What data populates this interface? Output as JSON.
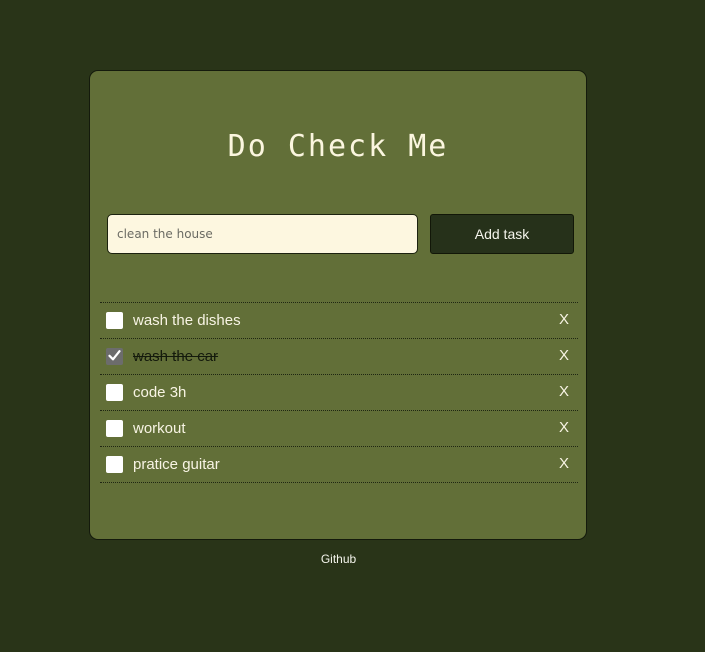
{
  "app": {
    "title": "Do Check Me"
  },
  "form": {
    "input_placeholder": "clean the house",
    "input_value": "",
    "add_button_label": "Add task"
  },
  "tasks": [
    {
      "label": "wash the dishes",
      "done": false,
      "delete_label": "X"
    },
    {
      "label": "wash the car",
      "done": true,
      "delete_label": "X"
    },
    {
      "label": "code 3h",
      "done": false,
      "delete_label": "X"
    },
    {
      "label": "workout",
      "done": false,
      "delete_label": "X"
    },
    {
      "label": "pratice guitar",
      "done": false,
      "delete_label": "X"
    }
  ],
  "footer": {
    "link_label": "Github"
  },
  "colors": {
    "page_background": "#293418",
    "card_background": "#626f38",
    "input_background": "#fdf7e0",
    "button_background": "#26311a",
    "title_color": "#fbf6df"
  }
}
